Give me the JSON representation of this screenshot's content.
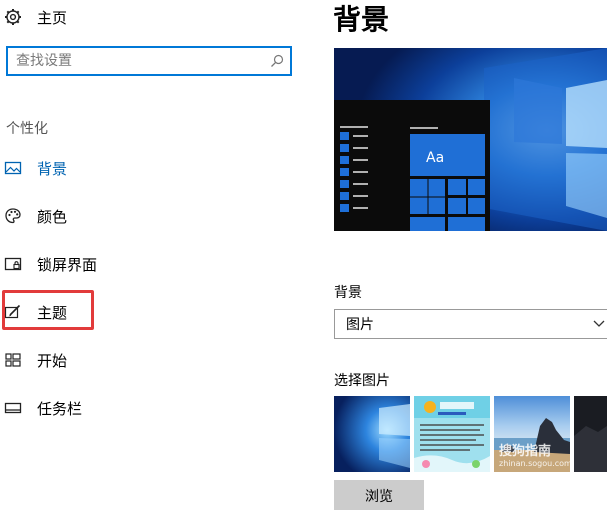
{
  "sidebar": {
    "home_label": "主页",
    "search": {
      "placeholder": "查找设置",
      "value": ""
    },
    "section_title": "个性化",
    "items": [
      {
        "id": "background",
        "label": "背景",
        "icon": "picture-icon",
        "active": true
      },
      {
        "id": "colors",
        "label": "颜色",
        "icon": "palette-icon",
        "active": false
      },
      {
        "id": "lockscreen",
        "label": "锁屏界面",
        "icon": "lock-screen-icon",
        "active": false
      },
      {
        "id": "themes",
        "label": "主题",
        "icon": "brush-icon",
        "active": false
      },
      {
        "id": "start",
        "label": "开始",
        "icon": "start-icon",
        "active": false
      },
      {
        "id": "taskbar",
        "label": "任务栏",
        "icon": "taskbar-icon",
        "active": false
      }
    ]
  },
  "main": {
    "title": "背景",
    "preview_text": "Aa",
    "background_label": "背景",
    "background_select": {
      "value": "图片"
    },
    "choose_picture_label": "选择图片",
    "thumbnails": [
      {
        "name": "windows-hero"
      },
      {
        "name": "flyer"
      },
      {
        "name": "beach-rocks"
      },
      {
        "name": "dark-partial"
      }
    ],
    "browse_label": "浏览"
  },
  "watermark": {
    "brand": "搜狗指南",
    "url": "zhinan.sogou.com"
  },
  "colors": {
    "accent": "#0078d7",
    "active_text": "#0063b1",
    "highlight_box": "#e23b3b",
    "tile_blue": "#1f6fd6"
  }
}
